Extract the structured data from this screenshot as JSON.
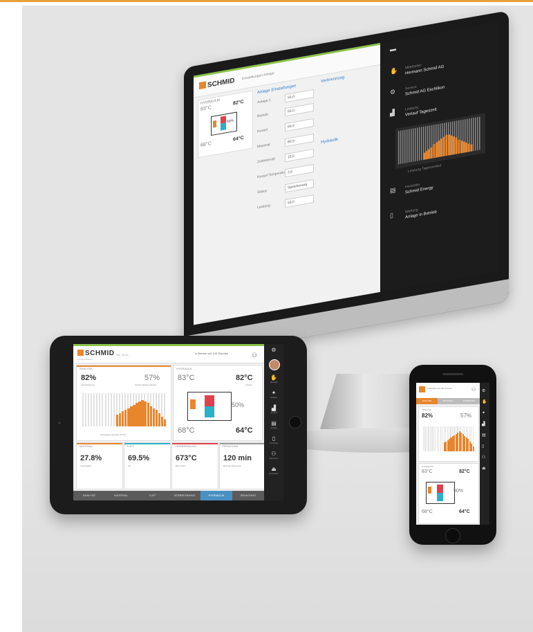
{
  "desktop": {
    "header": {
      "logo": "SCHMID",
      "breadcrumb": "Einstellungen Anlage"
    },
    "widget": {
      "label": "HYDRAULIK",
      "temp_top_left": "83°C",
      "temp_top_right": "82°C",
      "percent": "50%",
      "temp_bottom_left": "68°C",
      "temp_bottom_right": "64°C"
    },
    "tab_left": "Anlage Einstellungen",
    "tab_right": "Verbrennung",
    "tab_lower": "Hydraulik",
    "fields": [
      {
        "label": "Anlage 1",
        "value": "50,0"
      },
      {
        "label": "Betrieb",
        "value": "50,0"
      },
      {
        "label": "Kessel",
        "value": "60,9"
      },
      {
        "label": "Maximal",
        "value": "80,9"
      },
      {
        "label": "Zeitintervall",
        "value": "10,0"
      },
      {
        "label": "Kessel Temperatur",
        "value": "2,0"
      },
      {
        "label": "Status",
        "value": "Speicherung"
      },
      {
        "label": "Leistung",
        "value": "50,0"
      }
    ],
    "side": [
      {
        "small": "",
        "big": ""
      },
      {
        "small": "Mitarbeiter",
        "big": "Hermann Schmid AG"
      },
      {
        "small": "Service",
        "big": "Schmid AG Eschlikon"
      },
      {
        "small": "Leistung",
        "big": "Verlauf Tageszeit"
      },
      {
        "small": "Hersteller",
        "big": "Schmid Energy"
      },
      {
        "small": "Wartung",
        "big": "Anlage in Betrieb"
      }
    ],
    "side_chart_label": "Leistung Tagesverlauf"
  },
  "tablet": {
    "logo": "SCHMID",
    "logo_sub": "energy solutions",
    "version": "Ver. 10.01",
    "status": "In Betrieb seit 100 Stunden",
    "analyse": {
      "title": "ANALYSE",
      "left_value": "82%",
      "left_sub": "Kesselleistung",
      "right_value": "57%",
      "right_sub": "Speicherladung Aktuell"
    },
    "chart_label": "Kesselleistung letzte 24 Std.",
    "hydraulik": {
      "title": "HYDRAULIK",
      "temp_top_left": "83°C",
      "temp_top_right": "82°C",
      "sub_top_right": "Vorlauf",
      "percent": "50%",
      "temp_bottom_left": "68°C",
      "temp_bottom_right": "64°C"
    },
    "kpis": [
      {
        "title": "MATERIAL",
        "value": "27.8%",
        "sub": "Feuchtigkeit",
        "color": "#e8862c"
      },
      {
        "title": "LUFT",
        "value": "69.5%",
        "sub": "O2",
        "color": "#2bb0c8"
      },
      {
        "title": "VERBRENNUNG",
        "value": "673°C",
        "sub": "Brennraum",
        "color": "#e0404e"
      },
      {
        "title": "REINIGUNG",
        "value": "120 min",
        "sub": "Reinigungsintervall",
        "color": "#999999"
      }
    ],
    "tabs": [
      {
        "label": "ANALYSE",
        "active": false
      },
      {
        "label": "MATERIAL",
        "active": false
      },
      {
        "label": "LUFT",
        "active": false
      },
      {
        "label": "VERBRENNUNG",
        "active": false
      },
      {
        "label": "HYDRAULIK",
        "active": true
      },
      {
        "label": "REINIGUNG",
        "active": false
      }
    ],
    "sidebar": [
      {
        "icon": "gear-icon",
        "glyph": "⚙",
        "label": ""
      },
      {
        "icon": "avatar",
        "glyph": "",
        "label": ""
      },
      {
        "icon": "hand-icon",
        "glyph": "✋",
        "label": "Manuell"
      },
      {
        "icon": "wrench-icon",
        "glyph": "✦",
        "label": "Analyse"
      },
      {
        "icon": "chart-icon",
        "glyph": "▟",
        "label": "Verlauf"
      },
      {
        "icon": "factory-icon",
        "glyph": "▤",
        "label": "Anlage"
      },
      {
        "icon": "document-icon",
        "glyph": "▯",
        "label": "Protokoll"
      },
      {
        "icon": "user-icon",
        "glyph": "⚇",
        "label": "Benutzer"
      },
      {
        "icon": "logout-icon",
        "glyph": "⏏",
        "label": "Abmelden"
      }
    ],
    "colors": {
      "orange": "#e8862c",
      "green": "#8bc34a",
      "blue_tab": "#4a90c2"
    }
  },
  "phone": {
    "header_text": "In Betrieb seit 100 Stunden",
    "tabs": [
      {
        "label": "ANALYSE",
        "active": true
      },
      {
        "label": "MATERIAL",
        "active": false
      },
      {
        "label": "HYDRAULIK",
        "active": false
      }
    ],
    "analyse": {
      "title": "ANALYSE",
      "left_value": "82%",
      "right_value": "57%"
    },
    "hydraulik": {
      "title": "HYDRAULIK",
      "temp_top_left": "83°C",
      "temp_top_right": "82°C",
      "percent": "50%",
      "temp_bottom_left": "68°C",
      "temp_bottom_right": "64°C"
    },
    "sidebar_glyphs": [
      "⚙",
      "✋",
      "✦",
      "▟",
      "▤",
      "▯",
      "⚇",
      "⏏"
    ]
  }
}
